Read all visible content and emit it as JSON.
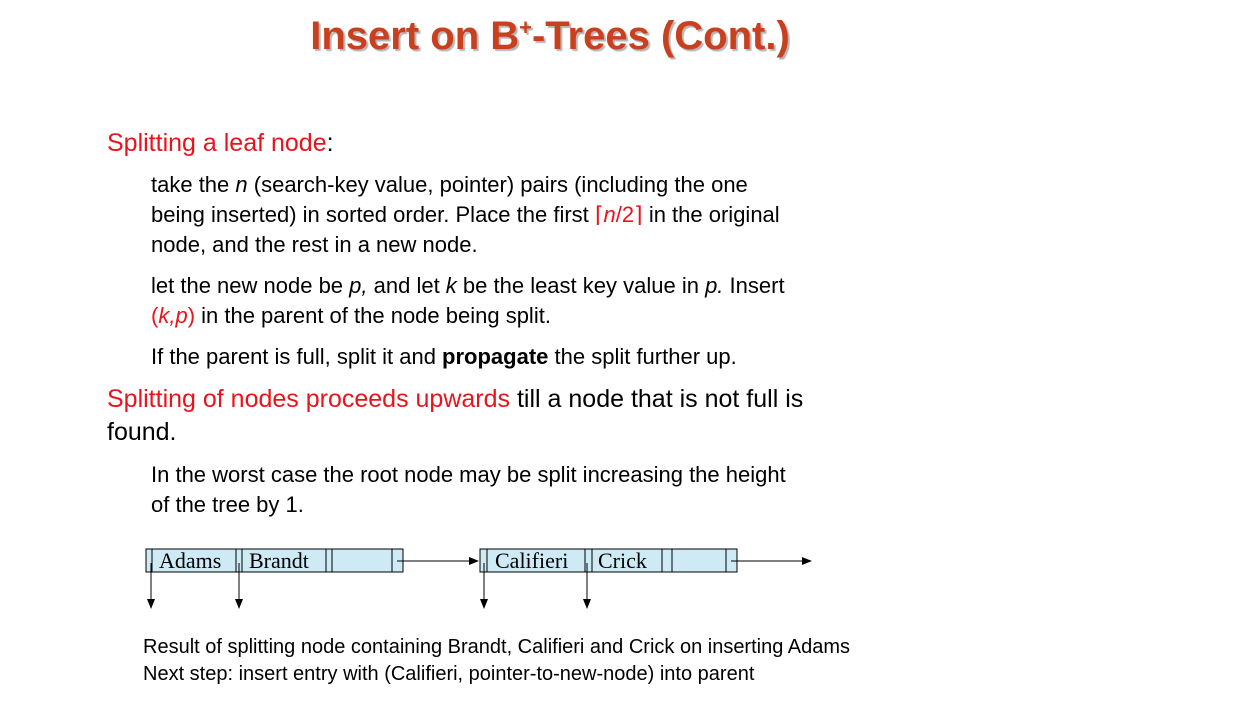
{
  "title": {
    "main": "Insert on B",
    "sup": "+",
    "rest": "-Trees (Cont.)"
  },
  "section1": {
    "heading": "Splitting a leaf node",
    "heading_suffix": ":",
    "bullet1": {
      "line1_a": "take the ",
      "line1_n": "n",
      "line1_b": " (search-key value, pointer) pairs (including the one",
      "line2_a": "being inserted) in sorted order.  Place the first ",
      "ceil_left": "⌈",
      "ceil_n": "n",
      "ceil_rest": "/2",
      "ceil_right": "⌉",
      "line2_b": " in the original",
      "line3": "node, and the rest in a new node."
    },
    "bullet2": {
      "line1_a": "let the new node be ",
      "line1_p": "p,",
      "line1_b": " and let ",
      "line1_k": "k",
      "line1_c": " be the least key value in ",
      "line1_p2": "p.",
      "line1_d": "  Insert",
      "line2_open": "(",
      "line2_kp": "k,p",
      "line2_close": ")",
      "line2_b": " in the parent of the node being split."
    },
    "bullet3": {
      "a": "If the parent is full, split it and ",
      "bold": "propagate",
      "b": " the split further up."
    }
  },
  "section2": {
    "heading_red": "Splitting of nodes proceeds upwards",
    "heading_rest": " till a node that is not full is",
    "heading_line2": "found.",
    "bullet1_line1": "In the worst case the root node may be split increasing the height",
    "bullet1_line2": "of the tree by 1."
  },
  "diagram": {
    "node1_keys": [
      "Adams",
      "Brandt"
    ],
    "node2_keys": [
      "Califieri",
      "Crick"
    ],
    "fill_color": "#cdeaf5"
  },
  "caption": {
    "line1": "Result of splitting node containing Brandt, Califieri and Crick on inserting Adams",
    "line2": "Next step: insert entry with (Califieri, pointer-to-new-node) into parent"
  }
}
